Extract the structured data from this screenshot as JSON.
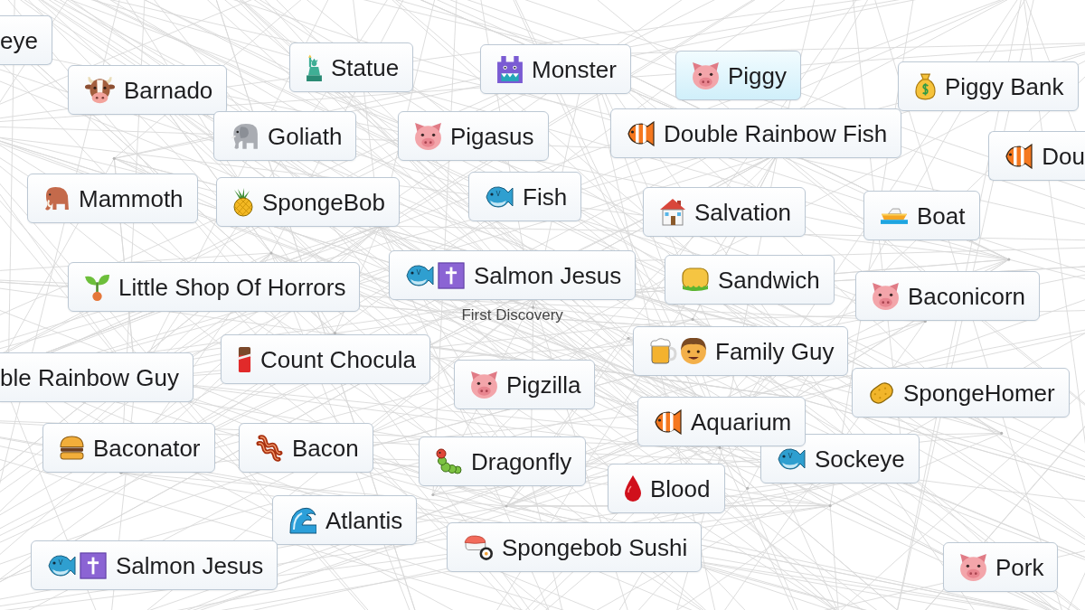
{
  "canvas": {
    "items": [
      {
        "label": "eye",
        "selected": false
      },
      {
        "label": "Barnado",
        "selected": false
      },
      {
        "label": "Statue",
        "selected": false
      },
      {
        "label": "Monster",
        "selected": false
      },
      {
        "label": "Piggy",
        "selected": true
      },
      {
        "label": "Piggy Bank",
        "selected": false
      },
      {
        "label": "Goliath",
        "selected": false
      },
      {
        "label": "Pigasus",
        "selected": false
      },
      {
        "label": "Double Rainbow Fish",
        "selected": false
      },
      {
        "label": "Dou",
        "selected": false
      },
      {
        "label": "Mammoth",
        "selected": false
      },
      {
        "label": "SpongeBob",
        "selected": false
      },
      {
        "label": "Fish",
        "selected": false
      },
      {
        "label": "Salvation",
        "selected": false
      },
      {
        "label": "Boat",
        "selected": false
      },
      {
        "label": "Little Shop Of Horrors",
        "selected": false
      },
      {
        "label": "Salmon Jesus",
        "selected": false,
        "caption": "First Discovery"
      },
      {
        "label": "Sandwich",
        "selected": false
      },
      {
        "label": "Baconicorn",
        "selected": false
      },
      {
        "label": "ble Rainbow Guy",
        "selected": false
      },
      {
        "label": "Count Chocula",
        "selected": false
      },
      {
        "label": "Family Guy",
        "selected": false
      },
      {
        "label": "Pigzilla",
        "selected": false
      },
      {
        "label": "SpongeHomer",
        "selected": false
      },
      {
        "label": "Aquarium",
        "selected": false
      },
      {
        "label": "Baconator",
        "selected": false
      },
      {
        "label": "Bacon",
        "selected": false
      },
      {
        "label": "Dragonfly",
        "selected": false
      },
      {
        "label": "Blood",
        "selected": false
      },
      {
        "label": "Sockeye",
        "selected": false
      },
      {
        "label": "Atlantis",
        "selected": false
      },
      {
        "label": "Spongebob Sushi",
        "selected": false
      },
      {
        "label": "Salmon Jesus",
        "selected": false
      },
      {
        "label": "Pork",
        "selected": false
      }
    ]
  }
}
